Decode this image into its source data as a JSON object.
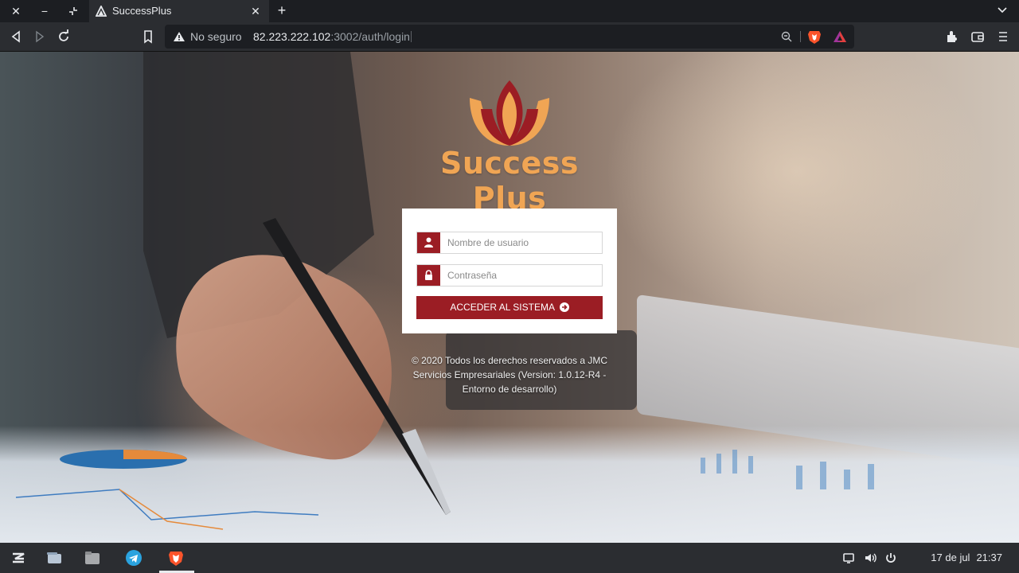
{
  "browser": {
    "tab_title": "SuccessPlus",
    "security_label": "No seguro",
    "url_host": "82.223.222.102",
    "url_rest": ":3002/auth/login"
  },
  "brand": {
    "name": "Success Plus",
    "logo_colors": [
      "#9b1d24",
      "#f0a554"
    ]
  },
  "login": {
    "username_placeholder": "Nombre de usuario",
    "password_placeholder": "Contraseña",
    "submit_label": "ACCEDER AL SISTEMA",
    "accent_color": "#9b1d24"
  },
  "footer": {
    "copyright": "© 2020 Todos los derechos reservados a JMC Servicios Empresariales (Version: 1.0.12-R4 - Entorno de desarrollo)"
  },
  "taskbar": {
    "date": "17 de jul",
    "time": "21:37",
    "apps": [
      "zorin-menu-icon",
      "window-overview-icon",
      "files-icon",
      "telegram-icon",
      "brave-icon"
    ]
  },
  "icons": {
    "username": "user-icon",
    "password": "lock-icon",
    "submit": "arrow-circle-right-icon"
  }
}
